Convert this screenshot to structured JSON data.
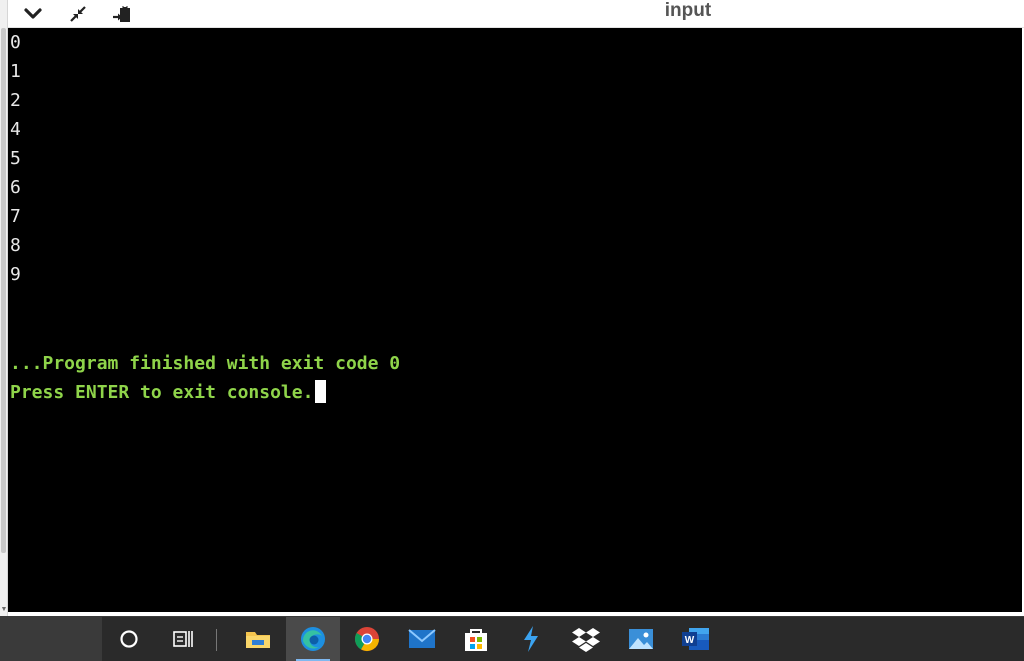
{
  "toolbar": {
    "title": "input",
    "buttons": [
      {
        "name": "collapse",
        "icon": "chevron-down-icon"
      },
      {
        "name": "minimize-panel",
        "icon": "arrows-inward-icon"
      },
      {
        "name": "copy-output",
        "icon": "clipboard-arrow-icon"
      }
    ]
  },
  "console": {
    "output_lines": [
      "0",
      "1",
      "2",
      "4",
      "5",
      "6",
      "7",
      "8",
      "9"
    ],
    "exit_message": "...Program finished with exit code 0",
    "prompt_message": "Press ENTER to exit console.",
    "text_color": "#e8e8e8",
    "message_color": "#8fd44a",
    "background": "#000000"
  },
  "taskbar": {
    "items": [
      {
        "name": "cortana",
        "icon": "cortana-ring-icon"
      },
      {
        "name": "task-view",
        "icon": "task-view-icon"
      },
      {
        "name": "file-explorer",
        "icon": "folder-icon"
      },
      {
        "name": "edge",
        "icon": "edge-icon",
        "active": true
      },
      {
        "name": "chrome",
        "icon": "chrome-icon"
      },
      {
        "name": "mail",
        "icon": "mail-icon"
      },
      {
        "name": "store",
        "icon": "store-bag-icon"
      },
      {
        "name": "visual-studio-code",
        "icon": "lightning-icon"
      },
      {
        "name": "dropbox",
        "icon": "dropbox-icon"
      },
      {
        "name": "photos",
        "icon": "photos-icon"
      },
      {
        "name": "word",
        "icon": "word-icon"
      }
    ]
  }
}
